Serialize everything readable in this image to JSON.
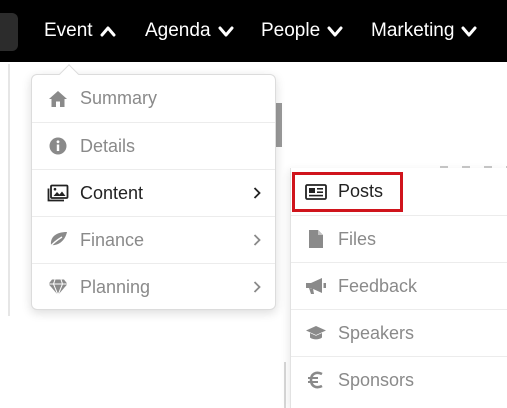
{
  "nav": {
    "items": [
      {
        "label": "Event",
        "icon": "chevron-up-icon"
      },
      {
        "label": "Agenda",
        "icon": "chevron-down-icon"
      },
      {
        "label": "People",
        "icon": "chevron-down-icon"
      },
      {
        "label": "Marketing",
        "icon": "chevron-down-icon"
      }
    ]
  },
  "event_menu": {
    "items": [
      {
        "label": "Summary",
        "icon": "home-icon",
        "has_submenu": false
      },
      {
        "label": "Details",
        "icon": "info-circle-icon",
        "has_submenu": false
      },
      {
        "label": "Content",
        "icon": "image-card-icon",
        "has_submenu": true,
        "active": true
      },
      {
        "label": "Finance",
        "icon": "leaf-icon",
        "has_submenu": true
      },
      {
        "label": "Planning",
        "icon": "diamond-icon",
        "has_submenu": true
      }
    ]
  },
  "content_submenu": {
    "items": [
      {
        "label": "Posts",
        "icon": "newspaper-icon",
        "highlighted": true
      },
      {
        "label": "Files",
        "icon": "file-icon"
      },
      {
        "label": "Feedback",
        "icon": "megaphone-icon"
      },
      {
        "label": "Speakers",
        "icon": "graduation-cap-icon"
      },
      {
        "label": "Sponsors",
        "icon": "euro-icon"
      }
    ]
  },
  "colors": {
    "nav_background": "#000000",
    "highlight_border": "#d0141c",
    "muted_text": "#8a8a8a",
    "dark_text": "#222222"
  }
}
